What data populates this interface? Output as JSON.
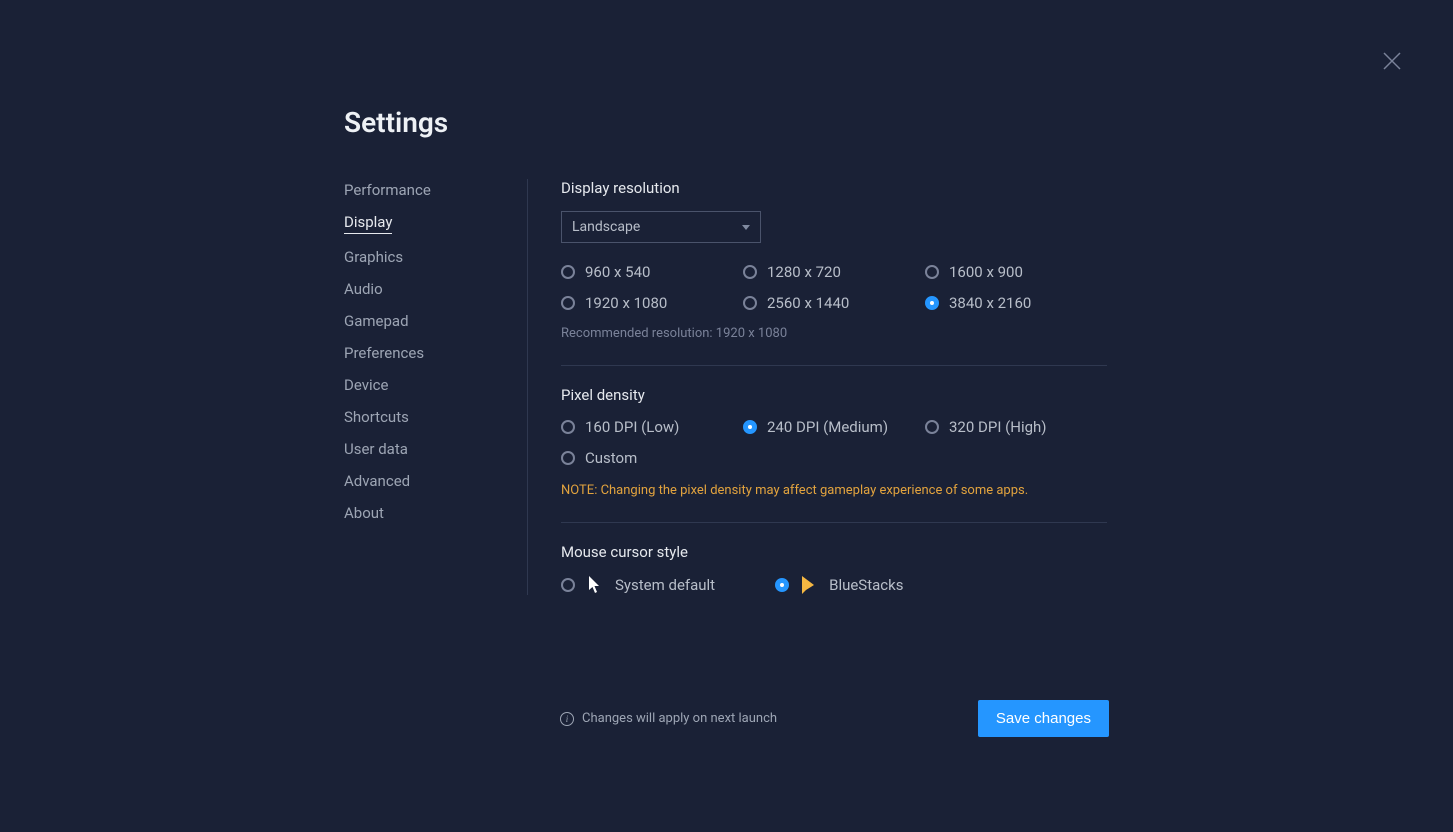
{
  "title": "Settings",
  "sidebar": {
    "items": [
      {
        "label": "Performance",
        "active": false
      },
      {
        "label": "Display",
        "active": true
      },
      {
        "label": "Graphics",
        "active": false
      },
      {
        "label": "Audio",
        "active": false
      },
      {
        "label": "Gamepad",
        "active": false
      },
      {
        "label": "Preferences",
        "active": false
      },
      {
        "label": "Device",
        "active": false
      },
      {
        "label": "Shortcuts",
        "active": false
      },
      {
        "label": "User data",
        "active": false
      },
      {
        "label": "Advanced",
        "active": false
      },
      {
        "label": "About",
        "active": false
      }
    ]
  },
  "display": {
    "resolution_title": "Display resolution",
    "orientation_selected": "Landscape",
    "resolutions": [
      {
        "label": "960 x 540",
        "checked": false
      },
      {
        "label": "1280 x 720",
        "checked": false
      },
      {
        "label": "1600 x 900",
        "checked": false
      },
      {
        "label": "1920 x 1080",
        "checked": false
      },
      {
        "label": "2560 x 1440",
        "checked": false
      },
      {
        "label": "3840 x 2160",
        "checked": true
      }
    ],
    "recommended": "Recommended resolution: 1920 x 1080",
    "density_title": "Pixel density",
    "densities": [
      {
        "label": "160 DPI (Low)",
        "checked": false
      },
      {
        "label": "240 DPI (Medium)",
        "checked": true
      },
      {
        "label": "320 DPI (High)",
        "checked": false
      },
      {
        "label": "Custom",
        "checked": false
      }
    ],
    "density_note": "NOTE: Changing the pixel density may affect gameplay experience of some apps.",
    "cursor_title": "Mouse cursor style",
    "cursor_options": [
      {
        "label": "System default",
        "checked": false,
        "icon": "system"
      },
      {
        "label": "BlueStacks",
        "checked": true,
        "icon": "bluestacks"
      }
    ]
  },
  "footer": {
    "notice": "Changes will apply on next launch",
    "save_label": "Save changes"
  }
}
